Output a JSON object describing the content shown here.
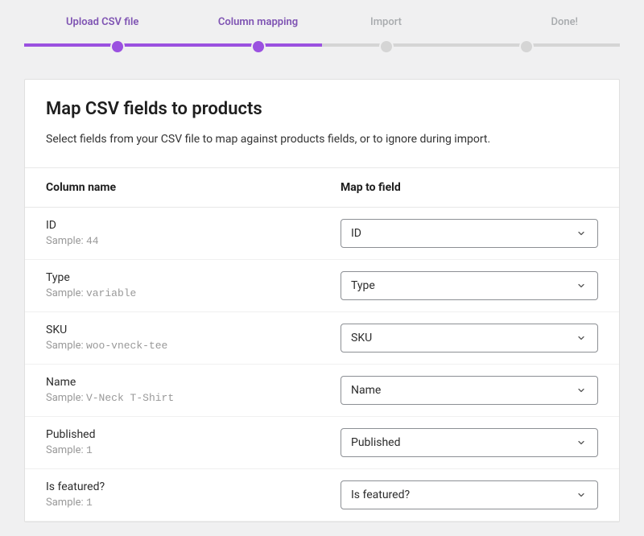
{
  "stepper": {
    "steps": [
      {
        "label": "Upload CSV file",
        "active": true
      },
      {
        "label": "Column mapping",
        "active": true
      },
      {
        "label": "Import",
        "active": false
      },
      {
        "label": "Done!",
        "active": false
      }
    ]
  },
  "page": {
    "title": "Map CSV fields to products",
    "description": "Select fields from your CSV file to map against products fields, or to ignore during import."
  },
  "table": {
    "header": {
      "column_name": "Column name",
      "map_to_field": "Map to field"
    },
    "sample_prefix": "Sample:",
    "rows": [
      {
        "name": "ID",
        "sample": "44",
        "mapped": "ID"
      },
      {
        "name": "Type",
        "sample": "variable",
        "mapped": "Type"
      },
      {
        "name": "SKU",
        "sample": "woo-vneck-tee",
        "mapped": "SKU"
      },
      {
        "name": "Name",
        "sample": "V-Neck T-Shirt",
        "mapped": "Name"
      },
      {
        "name": "Published",
        "sample": "1",
        "mapped": "Published"
      },
      {
        "name": "Is featured?",
        "sample": "1",
        "mapped": "Is featured?"
      }
    ]
  }
}
